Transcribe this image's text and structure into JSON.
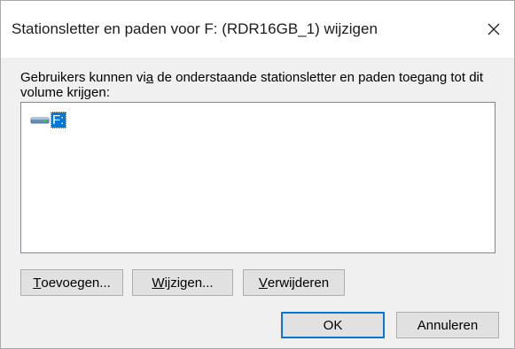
{
  "window": {
    "title": "Stationsletter en paden voor F: (RDR16GB_1) wijzigen",
    "close_icon": "close-icon"
  },
  "description": {
    "part1": "Gebruikers kunnen vi",
    "part2": "a",
    "part3": " de onderstaande stationsletter en paden toegang tot dit volume krijgen:"
  },
  "listbox": {
    "items": [
      {
        "label": "F:",
        "icon": "drive-icon",
        "selected": true
      }
    ]
  },
  "buttons": {
    "add": {
      "mnemonic": "T",
      "rest": "oevoegen..."
    },
    "change": {
      "mnemonic": "W",
      "rest": "ijzigen..."
    },
    "remove": {
      "mnemonic": "V",
      "rest": "erwijderen"
    },
    "ok": "OK",
    "cancel": "Annuleren"
  },
  "colors": {
    "selection": "#0078d7",
    "button_face": "#e1e1e1",
    "dialog_bg": "#f0f0f0"
  }
}
